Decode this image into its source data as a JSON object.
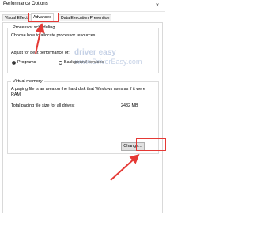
{
  "window": {
    "title": "Performance Options",
    "close_glyph": "×"
  },
  "tabs": [
    {
      "label": "Visual Effects"
    },
    {
      "label": "Advanced"
    },
    {
      "label": "Data Execution Prevention"
    }
  ],
  "processor_scheduling": {
    "legend": "Processor scheduling",
    "description": "Choose how to allocate processor resources.",
    "adjust_label": "Adjust for best performance of:",
    "options": [
      {
        "label": "Programs",
        "checked": true
      },
      {
        "label": "Background services",
        "checked": false
      }
    ]
  },
  "virtual_memory": {
    "legend": "Virtual memory",
    "description": "A paging file is an area on the hard disk that Windows uses as if it were RAM.",
    "total_label": "Total paging file size for all drives:",
    "total_value": "2432 MB",
    "change_button": "Change..."
  },
  "watermark": {
    "brand": "driver easy",
    "url": "www.DriverEasy.com"
  },
  "annotations": {
    "highlight_color": "#e53935"
  }
}
